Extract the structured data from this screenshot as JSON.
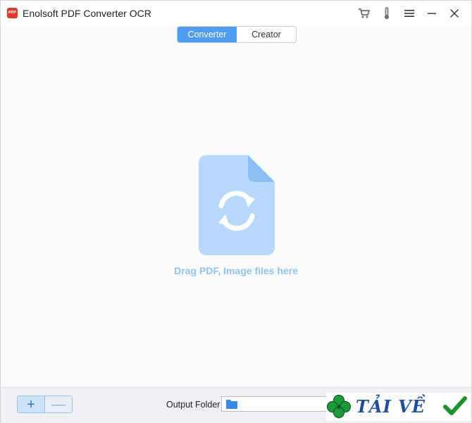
{
  "window": {
    "logo_text": "PDF",
    "title": "Enolsoft PDF Converter OCR"
  },
  "titlebar_icons": [
    "cart-icon",
    "thermometer-icon",
    "menu-icon",
    "minimize-icon",
    "close-icon"
  ],
  "tabs": [
    {
      "label": "Converter",
      "active": true
    },
    {
      "label": "Creator",
      "active": false
    }
  ],
  "drop_area": {
    "icon": "file-sync-icon",
    "text": "Drag PDF, Image files here"
  },
  "bottom": {
    "add_label": "+",
    "remove_label": "—",
    "output_label": "Output Folder",
    "output_value": ""
  },
  "watermark": {
    "text": "TẢI VỀ"
  },
  "colors": {
    "accent": "#4f9cf0",
    "file_icon": "#b7d8fa",
    "drop_text": "#92c2ec",
    "logo": "#e03a2f"
  }
}
